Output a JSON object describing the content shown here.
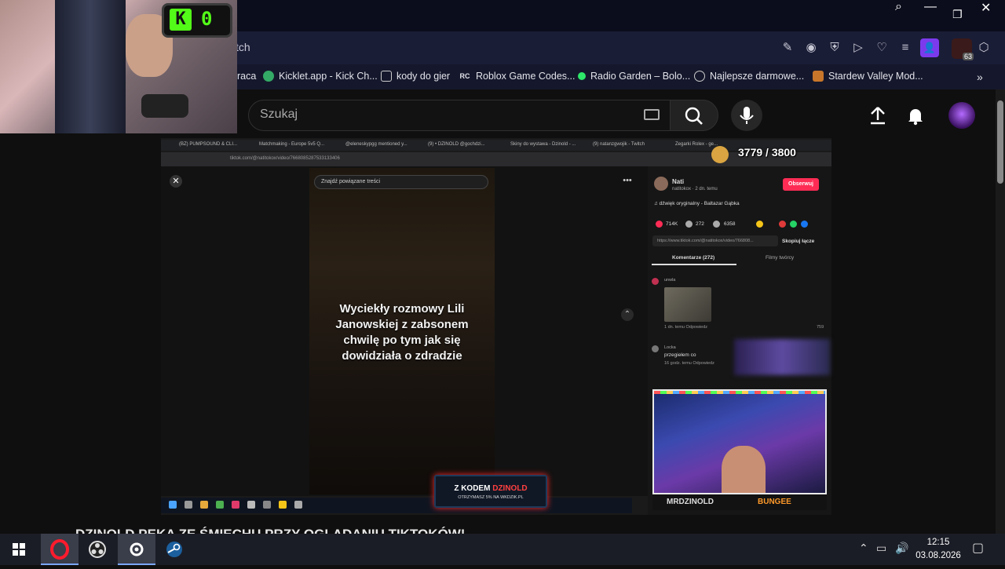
{
  "browser": {
    "url_fragment": "tch",
    "bookmarks": [
      {
        "label": "raca",
        "icon": "folder-icon"
      },
      {
        "label": "Kicklet.app - Kick Ch...",
        "icon": "kicklet-icon"
      },
      {
        "label": "kody do gier",
        "icon": "folder-icon"
      },
      {
        "label": "Roblox Game Codes...",
        "icon": "rc-icon"
      },
      {
        "label": "Radio Garden – Bolo...",
        "icon": "radio-icon"
      },
      {
        "label": "Najlepsze darmowe...",
        "icon": "emblem-icon"
      },
      {
        "label": "Stardew Valley Mod...",
        "icon": "stardew-icon"
      }
    ],
    "extension_badge": "63"
  },
  "youtube": {
    "search_placeholder": "Szukaj"
  },
  "stream": {
    "kick_score": "0",
    "kick_letter": "K",
    "goal_text": "3779 / 3800",
    "promo_line1_prefix": "Z KODEM",
    "promo_code": "DZINOLD",
    "promo_line2": "OTRZYMASZ 5% NA WKDZIK.PL",
    "socials": [
      "MRDZINOLD",
      "BUNGEE"
    ],
    "headline": "DZINOLD PĘKA ZE ŚMIECHU PRZY OGLĄDANIU TIKTOKÓW!"
  },
  "tiktok": {
    "search_placeholder": "Znajdź powiązane treści",
    "caption": "Wyciekły rozmowy Lili Janowskiej z zabsonem chwilę po tym jak się dowidziała o zdradzie",
    "author": "Nati",
    "author_sub": "natitokox · 2 dn. temu",
    "follow_label": "Obserwuj",
    "sound": "♫ dźwięk oryginalny - Baltazar Gąbka",
    "likes": "714K",
    "comments": "272",
    "saves": "6358",
    "copy_link_label": "Skopiuj łącze",
    "link_text": "https://www.tiktok.com/@natitokox/video/766808...",
    "tab_comments": "Komentarze (272)",
    "tab_creator": "Filmy twórcy",
    "comment1_user": "unwla",
    "comment1_meta": "1 dn. temu    Odpowiedz",
    "comment1_likes": "759",
    "comment2_user": "Locka",
    "comment2_text": "przegiełem co",
    "comment2_meta": "16 godz. temu    Odpowiedz",
    "inner_url": "tiktok.com/@natitokox/video/7668085287533133406",
    "inner_tabs": [
      "(BZ) PUMPSOUND & CLI...",
      "Matchmaking - Europe 5v5 Q...",
      "@eleneskypgg mentioned y...",
      "(9) • DZINOLD @gochdzi...",
      "Skiny do wystawa - Dzinold - ...",
      "(9) natanzgwojik - Twitch",
      "Zegarki Rolex - ge..."
    ]
  },
  "taskbar": {
    "time": "12:15",
    "date": "03.08.2026"
  }
}
